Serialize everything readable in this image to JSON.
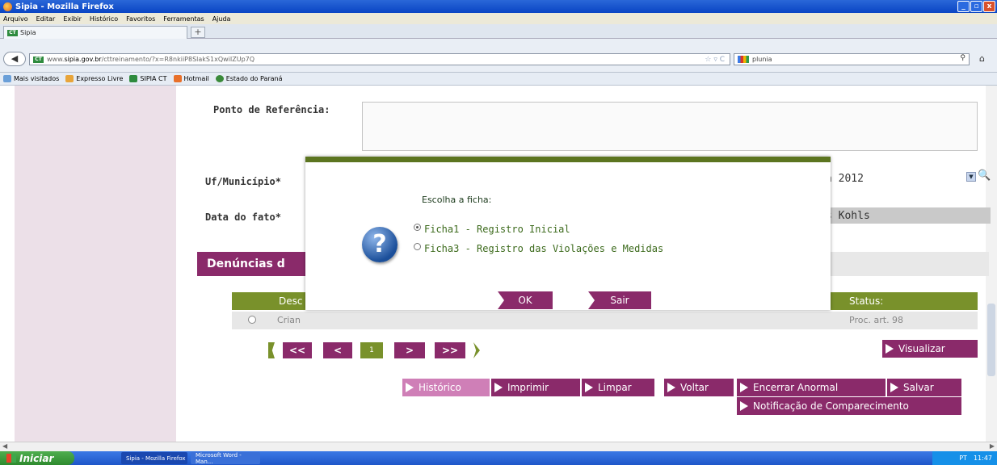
{
  "window": {
    "title": "Sipia - Mozilla Firefox",
    "controls": [
      "_",
      "▫",
      "x"
    ]
  },
  "menubar": [
    "Arquivo",
    "Editar",
    "Exibir",
    "Histórico",
    "Favoritos",
    "Ferramentas",
    "Ajuda"
  ],
  "tab": {
    "favicon_text": "CT",
    "label": "Sipia",
    "new_tab": "+"
  },
  "navbar": {
    "back": "◀",
    "url_prefix": "www.",
    "url_host": "sipia.gov.br",
    "url_path": "/cttreinamento/?x=R8nkiiP8SlakS1xQwiIZUp7Q",
    "search_text": "plunia"
  },
  "bookmarks": [
    "Mais visitados",
    "Expresso Livre",
    "SIPIA CT",
    "Hotmail",
    "Estado do Paraná"
  ],
  "form": {
    "ponto_label": "Ponto de Referência:",
    "uf_label": "Uf/Município*",
    "uf_value": "a 2012",
    "data_label": "Data do fato*",
    "data_value": "s Kohls"
  },
  "section": {
    "title": "Denúncias d"
  },
  "table": {
    "headers": [
      "Desc",
      "Status:"
    ],
    "rows": [
      {
        "desc": "Crian",
        "status": "Proc. art. 98"
      }
    ]
  },
  "pager": {
    "first": "<<",
    "prev": "<",
    "current": "1",
    "next": ">",
    "last": ">>"
  },
  "buttons": {
    "visualizar": "Visualizar",
    "historico": "Histórico",
    "imprimir": "Imprimir",
    "limpar": "Limpar",
    "voltar": "Voltar",
    "encerrar": "Encerrar Anormal",
    "salvar": "Salvar",
    "notificacao": "Notificação de Comparecimento"
  },
  "dialog": {
    "title": "Escolha a ficha:",
    "options": [
      {
        "label": "Ficha1 - Registro Inicial",
        "selected": true
      },
      {
        "label": "Ficha3 - Registro das Violações e Medidas",
        "selected": false
      }
    ],
    "ok": "OK",
    "sair": "Sair"
  },
  "taskbar": {
    "start": "Iniciar",
    "items": [
      "Sipia - Mozilla Firefox",
      "Microsoft Word - Man..."
    ],
    "tray_lang": "PT",
    "clock": "11:47"
  },
  "colors": {
    "accent_purple": "#8a2a6a",
    "accent_green": "#79912b",
    "dialog_text_green": "#3c6a1c"
  }
}
